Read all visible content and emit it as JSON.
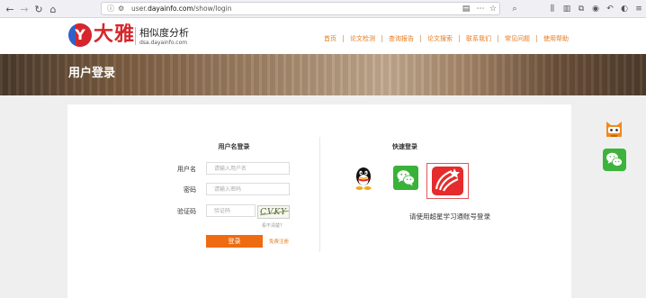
{
  "browser": {
    "url_prefix": "user.",
    "url_domain": "dayainfo.com",
    "url_path": "/show/login"
  },
  "site": {
    "logo_text": "大雅",
    "logo_tagline": "相似度分析",
    "logo_domain": "dsa.dayainfo.com",
    "nav": [
      "首页",
      "论文检测",
      "查询报告",
      "论文搜索",
      "联系我们",
      "常见问题",
      "使用帮助"
    ]
  },
  "banner": {
    "title": "用户登录"
  },
  "login_form": {
    "heading": "用户名登录",
    "username_label": "用户名",
    "username_placeholder": "请输入用户名",
    "password_label": "密码",
    "password_placeholder": "请输入密码",
    "captcha_label": "验证码",
    "captcha_placeholder": "验证码",
    "captcha_text": "CVKY",
    "captcha_refresh": "看不清楚?",
    "login_button": "登录",
    "register_link": "免费注册"
  },
  "quick_login": {
    "heading": "快速登录",
    "hint": "请使用超星学习通账号登录"
  },
  "colors": {
    "accent": "#ee6b12",
    "nav_text": "#e67a1a",
    "logo_red": "#d7262b",
    "logo_blue": "#2f62c8",
    "wechat_green": "#3ab238"
  }
}
